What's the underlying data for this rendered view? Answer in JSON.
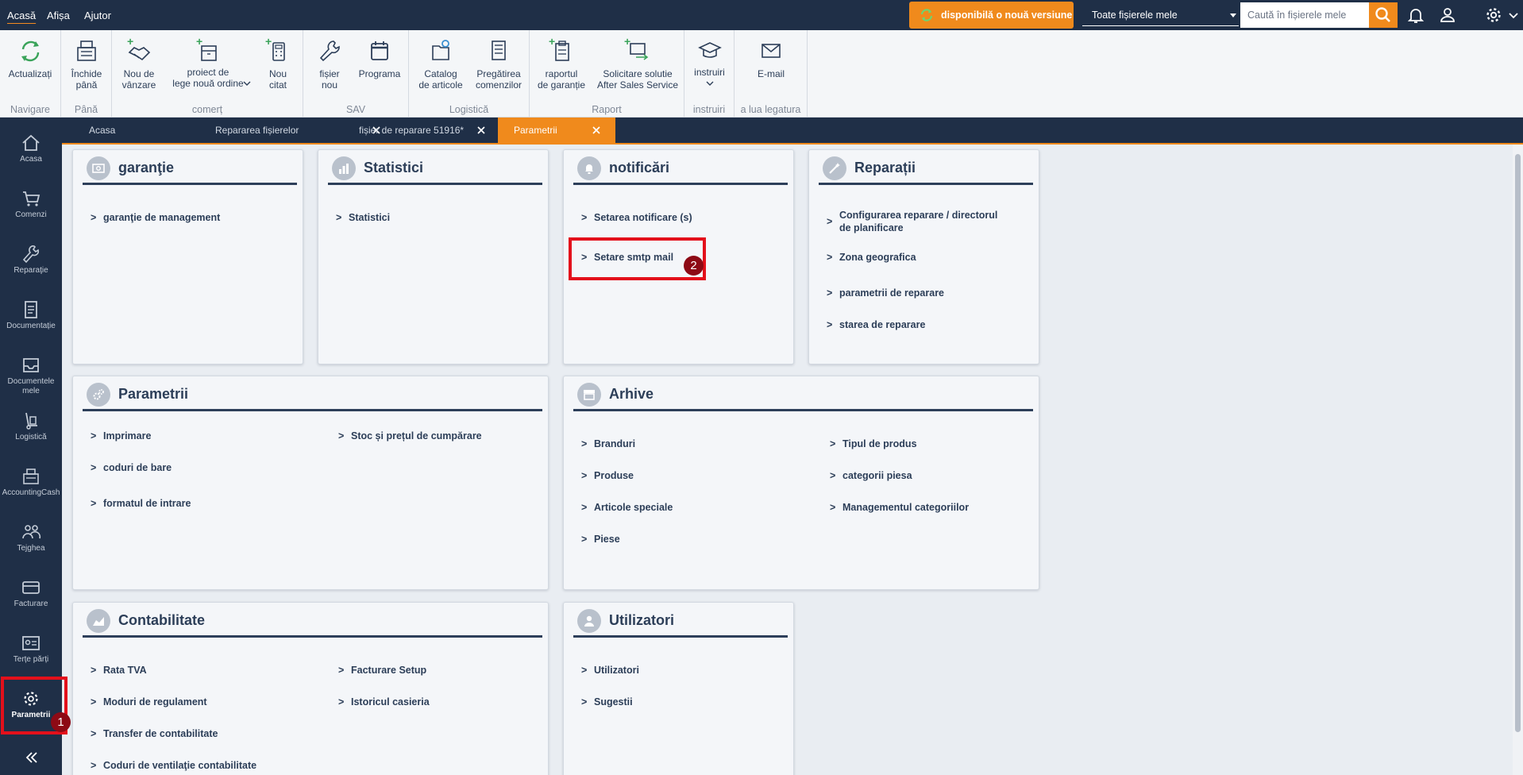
{
  "topbar": {
    "menu": [
      "Acasă",
      "Afișa",
      "Ajutor"
    ],
    "update_label": "disponibilă o nouă versiune",
    "filter_value": "Toate fișierele mele",
    "search_placeholder": "Caută în fișierele mele"
  },
  "ribbon": {
    "groups": [
      "Navigare",
      "Până",
      "comerț",
      "SAV",
      "Logistică",
      "Raport",
      "instruiri",
      "a lua legatura"
    ],
    "buttons": [
      "Actualizați",
      "Închide\npână",
      "Nou de\nvânzare",
      "proiect de\nlege nouă ordine",
      "Nou\ncitat",
      "fișier\nnou",
      "Programa",
      "Catalog\nde articole",
      "Pregătirea\ncomenzilor",
      "raportul\nde garanție",
      "Solicitare solutie\nAfter Sales Service",
      "instruiri",
      "E-mail"
    ]
  },
  "sidebar": {
    "items": [
      "Acasa",
      "Comenzi",
      "Reparaţie",
      "Documentație",
      "Documentele\nmele",
      "Logistică",
      "AccountingCash",
      "Tejghea",
      "Facturare",
      "Terțe părți",
      "Parametrii"
    ]
  },
  "tabs": [
    "Acasa",
    "Repararea fișierelor",
    "fișier de reparare 51916*",
    "Parametrii"
  ],
  "cards": {
    "garantie": {
      "title": "garanţie",
      "links": [
        "garanţie de management"
      ]
    },
    "statistici": {
      "title": "Statistici",
      "links": [
        "Statistici"
      ]
    },
    "notificari": {
      "title": "notificări",
      "links": [
        "Setarea notificare (s)",
        "Setare smtp mail"
      ]
    },
    "reparatii": {
      "title": "Reparații",
      "links": [
        "Configurarea reparare / directorul de planificare",
        "Zona geografica",
        "parametrii de reparare",
        "starea de reparare"
      ]
    },
    "parametrii": {
      "title": "Parametrii",
      "links": [
        "Imprimare",
        "coduri de bare",
        "formatul de intrare",
        "Stoc și prețul de cumpărare"
      ]
    },
    "arhive": {
      "title": "Arhive",
      "links": [
        "Branduri",
        "Produse",
        "Articole speciale",
        "Piese",
        "Tipul de produs",
        "categorii piesa",
        "Managementul categoriilor"
      ]
    },
    "contabilitate": {
      "title": "Contabilitate",
      "links": [
        "Rata TVA",
        "Moduri de regulament",
        "Transfer de contabilitate",
        "Coduri de ventilaţie contabilitate",
        "Facturare Setup",
        "Istoricul casieria"
      ]
    },
    "utilizatori": {
      "title": "Utilizatori",
      "links": [
        "Utilizatori",
        "Sugestii"
      ]
    }
  },
  "annotations": {
    "badge1": "1",
    "badge2": "2"
  },
  "colors": {
    "navy": "#1f2f47",
    "accent": "#f08a1c",
    "highlight": "#e3101b"
  }
}
